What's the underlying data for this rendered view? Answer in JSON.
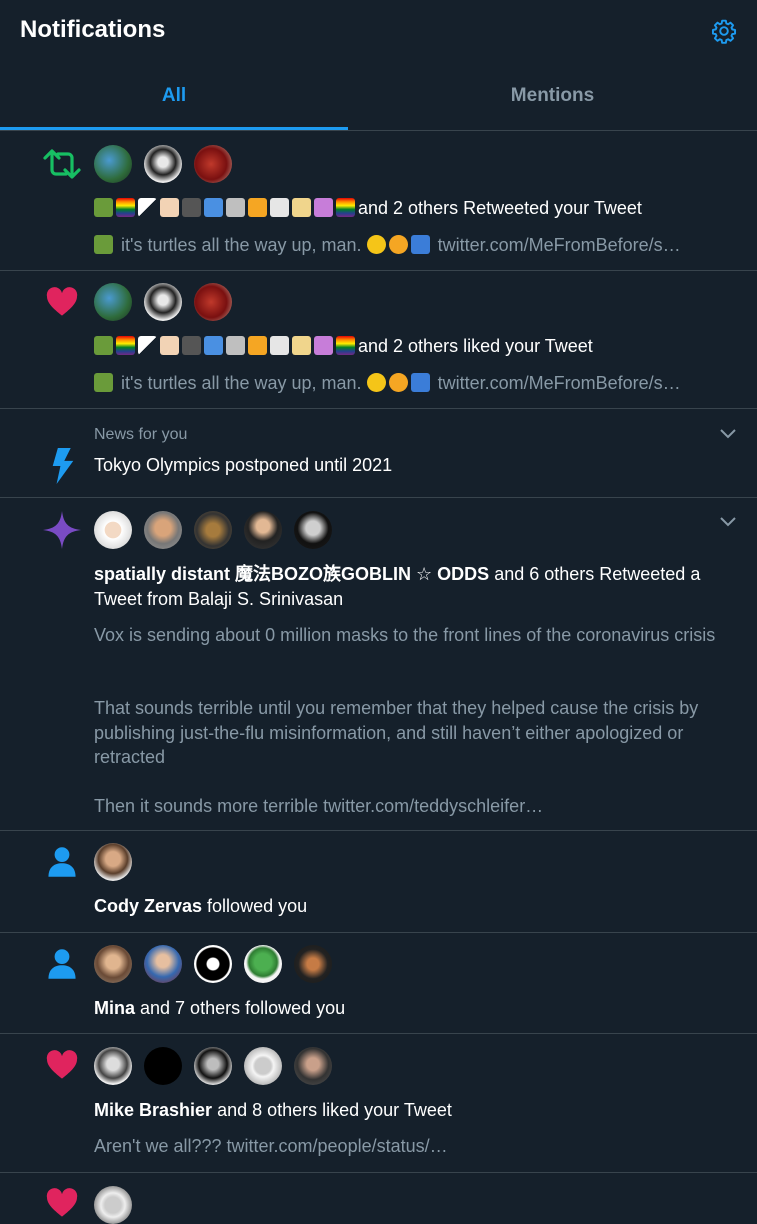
{
  "header": {
    "title": "Notifications"
  },
  "tabs": [
    {
      "label": "All"
    },
    {
      "label": "Mentions"
    }
  ],
  "notifications": [
    {
      "type": "retweet",
      "actor_text": "and 2 others Retweeted your Tweet",
      "tweet_text": "it's turtles all the way up, man.",
      "tweet_link": "twitter.com/MeFromBefore/s…"
    },
    {
      "type": "like",
      "actor_text": "and 2 others liked your Tweet",
      "tweet_text": "it's turtles all the way up, man.",
      "tweet_link": "twitter.com/MeFromBefore/s…"
    },
    {
      "type": "news",
      "label": "News for you",
      "headline": "Tokyo Olympics postponed until 2021"
    },
    {
      "type": "recommended-retweet",
      "actor_name": "spatially distant 魔法BOZO族GOBLIN ☆ ODDS",
      "actor_text": " and 6 others Retweeted a Tweet from Balaji S. Srinivasan",
      "tweet_p1": "Vox is sending about 0 million masks to the front lines of the coronavirus crisis",
      "tweet_p2": "That sounds terrible until you remember that they helped cause the crisis by publishing just-the-flu misinformation, and still haven’t either apologized or retracted",
      "tweet_p3": "Then it sounds more terrible twitter.com/teddyschleifer…"
    },
    {
      "type": "follow",
      "actor_name": "Cody Zervas",
      "actor_text": " followed you"
    },
    {
      "type": "follow",
      "actor_name": "Mina",
      "actor_text": " and 7 others followed you"
    },
    {
      "type": "like",
      "actor_name": "Mike Brashier",
      "actor_text": " and 8 others liked your Tweet",
      "tweet_text": "Aren't we all??? twitter.com/people/status/…"
    }
  ],
  "colors": {
    "background": "#15202b",
    "accent": "#1d9bf0",
    "retweet": "#17bf63",
    "like": "#e0245e",
    "muted": "#8899a6",
    "divider": "#38444d"
  },
  "icons": [
    "gear-icon",
    "retweet-icon",
    "heart-icon",
    "lightning-icon",
    "sparkle-icon",
    "person-icon",
    "chevron-down-icon"
  ]
}
